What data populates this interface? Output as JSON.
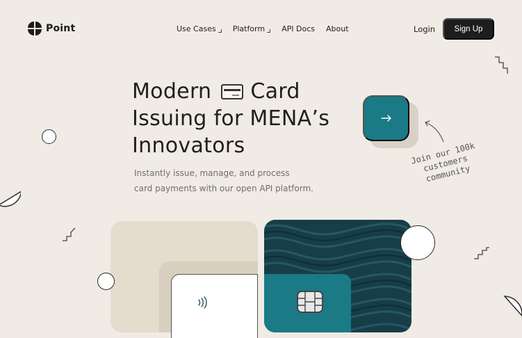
{
  "brand": {
    "name": "Point",
    "icon": "four-leaf-logo-icon"
  },
  "nav": {
    "items": [
      {
        "label": "Use Cases",
        "has_dropdown": true
      },
      {
        "label": "Platform",
        "has_dropdown": true
      },
      {
        "label": "API Docs",
        "has_dropdown": false
      },
      {
        "label": "About",
        "has_dropdown": false
      }
    ],
    "login_label": "Login",
    "signup_label": "Sign Up"
  },
  "hero": {
    "headline_line1_a": "Modern",
    "headline_line1_b": "Card",
    "headline_line2": "Issuing for MENA’s",
    "headline_line3": "Innovators",
    "subtitle_line1": "Instantly issue, manage, and process",
    "subtitle_line2": "card payments with our open API platform.",
    "cta_icon": "arrow-right-icon",
    "note": "Join our 100k customers community"
  },
  "colors": {
    "background": "#f0ebe4",
    "accent_teal": "#1a7a86",
    "dark_teal": "#173e48",
    "button_dark": "#1d1d1f"
  }
}
